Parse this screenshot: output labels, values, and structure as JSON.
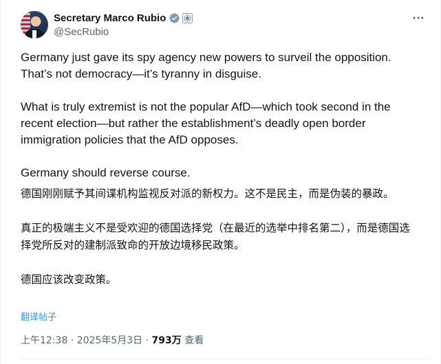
{
  "author": {
    "display_name": "Secretary Marco Rubio",
    "handle": "@SecRubio",
    "verified_icon": "verified-badge-icon",
    "affiliation_icon": "us-state-department-seal-icon",
    "more_icon": "more-horizontal-icon"
  },
  "post": {
    "paragraphs": [
      "Germany just gave its spy agency new powers to surveil the opposition. That’s not democracy—it’s tyranny in disguise.",
      "What is truly extremist is not the popular AfD—which took second in the recent election—but rather the establishment’s deadly open border immigration policies that the AfD opposes.",
      "Germany should reverse course."
    ],
    "translation_paragraphs": [
      "德国刚刚赋予其间谍机构监视反对派的新权力。这不是民主，而是伪装的暴政。",
      "真正的极端主义不是受欢迎的德国选择党（在最近的选举中排名第二），而是德国选择党所反对的建制派致命的开放边境移民政策。",
      "德国应该改变政策。"
    ],
    "translate_label": "翻译帖子"
  },
  "meta": {
    "time": "上午12:38",
    "separator": " · ",
    "date": "2025年5月3日",
    "views_count": "793万",
    "views_label": " 查看"
  },
  "colors": {
    "text": "#0f1419",
    "secondary": "#536471",
    "link": "#1d9bf0",
    "verified": "#829aab"
  }
}
